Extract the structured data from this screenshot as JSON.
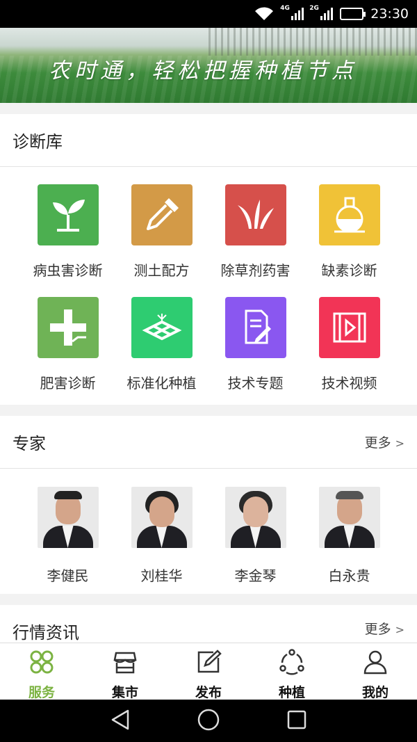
{
  "status_bar": {
    "time": "23:30",
    "net1": "4G",
    "net2": "2G",
    "battery_level": 0.8
  },
  "banner": {
    "slogan": "农时通，轻松把握种植节点"
  },
  "diagnosis": {
    "title": "诊断库",
    "items": [
      {
        "label": "病虫害诊断",
        "icon": "seedling-icon",
        "color": "#4caf50"
      },
      {
        "label": "测土配方",
        "icon": "dropper-icon",
        "color": "#d39a47"
      },
      {
        "label": "除草剂药害",
        "icon": "grass-icon",
        "color": "#d6504b"
      },
      {
        "label": "缺素诊断",
        "icon": "flask-icon",
        "color": "#f0c237"
      },
      {
        "label": "肥害诊断",
        "icon": "plus-icon",
        "color": "#6fb356"
      },
      {
        "label": "标准化种植",
        "icon": "field-plot-icon",
        "color": "#2ecc71"
      },
      {
        "label": "技术专题",
        "icon": "document-edit-icon",
        "color": "#8a57f0"
      },
      {
        "label": "技术视频",
        "icon": "video-icon",
        "color": "#f23456"
      }
    ]
  },
  "experts": {
    "title": "专家",
    "more": "更多",
    "people": [
      {
        "name": "李健民"
      },
      {
        "name": "刘桂华"
      },
      {
        "name": "李金琴"
      },
      {
        "name": "白永贵"
      }
    ]
  },
  "market_news": {
    "title": "行情资讯",
    "more": "更多"
  },
  "bottom_nav": {
    "items": [
      {
        "label": "服务",
        "icon": "clover-grid-icon",
        "active": true
      },
      {
        "label": "集市",
        "icon": "shop-icon",
        "active": false
      },
      {
        "label": "发布",
        "icon": "edit-square-icon",
        "active": false
      },
      {
        "label": "种植",
        "icon": "share-cycle-icon",
        "active": false
      },
      {
        "label": "我的",
        "icon": "user-icon",
        "active": false
      }
    ]
  },
  "colors": {
    "accent": "#7cb342"
  }
}
